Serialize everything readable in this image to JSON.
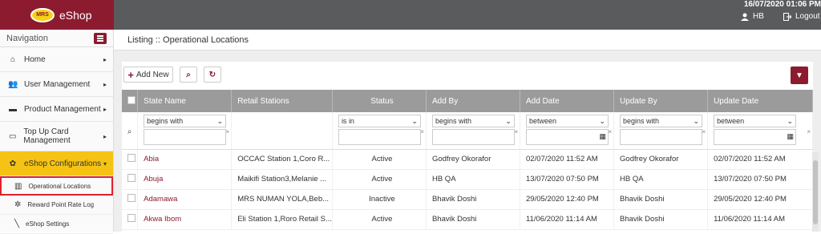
{
  "header": {
    "brand_badge": "MRS",
    "brand_name": "eShop",
    "datetime": "16/07/2020 01:06 PM",
    "user": "HB",
    "logout": "Logout"
  },
  "sidebar": {
    "title": "Navigation",
    "items": [
      {
        "label": "Home",
        "icon": "home-icon"
      },
      {
        "label": "User Management",
        "icon": "users-icon"
      },
      {
        "label": "Product Management",
        "icon": "box-icon"
      },
      {
        "label": "Top Up Card Management",
        "icon": "card-icon"
      },
      {
        "label": "eShop Configurations",
        "icon": "gear-icon"
      }
    ],
    "subitems": [
      {
        "label": "Operational Locations",
        "icon": "map-icon"
      },
      {
        "label": "Reward Point Rate Log",
        "icon": "gear-icon"
      },
      {
        "label": "eShop Settings",
        "icon": "wrench-icon"
      }
    ]
  },
  "page": {
    "title": "Listing :: Operational Locations",
    "add_label": "Add New"
  },
  "table": {
    "columns": [
      "State Name",
      "Retail Stations",
      "Status",
      "Add By",
      "Add Date",
      "Update By",
      "Update Date"
    ],
    "filters": [
      "begins with",
      "",
      "is in",
      "begins with",
      "between",
      "begins with",
      "between"
    ],
    "rows": [
      [
        "Abia",
        "OCCAC Station 1,Coro R...",
        "Active",
        "Godfrey Okorafor",
        "02/07/2020 11:52 AM",
        "Godfrey Okorafor",
        "02/07/2020 11:52 AM"
      ],
      [
        "Abuja",
        "Maikifi Station3,Melanie ...",
        "Active",
        "HB QA",
        "13/07/2020 07:50 PM",
        "HB QA",
        "13/07/2020 07:50 PM"
      ],
      [
        "Adamawa",
        "MRS NUMAN YOLA,Beb...",
        "Inactive",
        "Bhavik Doshi",
        "29/05/2020 12:40 PM",
        "Bhavik Doshi",
        "29/05/2020 12:40 PM"
      ],
      [
        "Akwa Ibom",
        "Eli Station 1,Roro Retail S...",
        "Active",
        "Bhavik Doshi",
        "11/06/2020 11:14 AM",
        "Bhavik Doshi",
        "11/06/2020 11:14 AM"
      ]
    ]
  }
}
